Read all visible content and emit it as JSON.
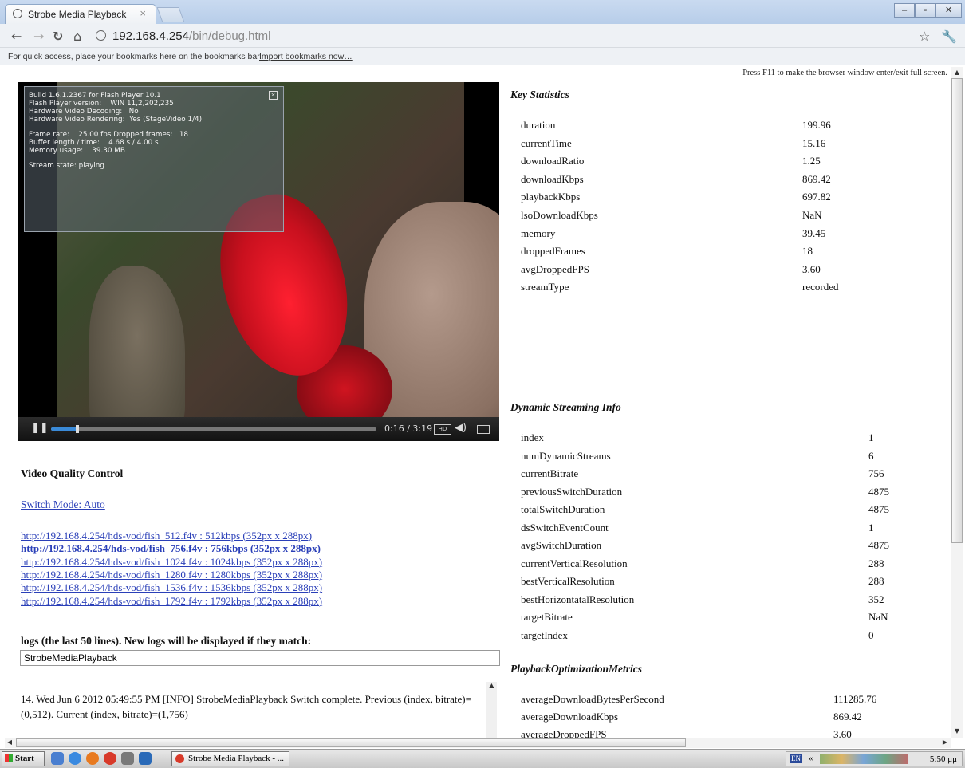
{
  "browser": {
    "tab_title": "Strobe Media Playback",
    "url_host": "192.168.4.254",
    "url_path": "/bin/debug.html",
    "bookmarks_hint": "For quick access, place your bookmarks here on the bookmarks bar.",
    "import_link": "Import bookmarks now…"
  },
  "page": {
    "fullscreen_hint": "Press F11 to make the browser window enter/exit full screen."
  },
  "player": {
    "overlay_lines": [
      "Build 1.6.1.2367 for Flash Player 10.1",
      "Flash Player version:    WIN 11,2,202,235",
      "Hardware Video Decoding:   No",
      "Hardware Video Rendering:  Yes (StageVideo 1/4)",
      "",
      "Frame rate:    25.00 fps Dropped frames:   18",
      "Buffer length / time:    4.68 s / 4.00 s",
      "Memory usage:    39.30 MB",
      "",
      "Stream state: playing"
    ],
    "time_display": "0:16 / 3:19",
    "progress_fraction": 0.08
  },
  "quality_control": {
    "title": "Video Quality Control",
    "switch_mode": "Switch Mode: Auto",
    "streams": [
      "http://192.168.4.254/hds-vod/fish_512.f4v : 512kbps (352px x 288px)",
      "http://192.168.4.254/hds-vod/fish_756.f4v : 756kbps (352px x 288px)",
      "http://192.168.4.254/hds-vod/fish_1024.f4v : 1024kbps (352px x 288px)",
      "http://192.168.4.254/hds-vod/fish_1280.f4v : 1280kbps (352px x 288px)",
      "http://192.168.4.254/hds-vod/fish_1536.f4v : 1536kbps (352px x 288px)",
      "http://192.168.4.254/hds-vod/fish_1792.f4v : 1792kbps (352px x 288px)"
    ],
    "active_stream_index": 1
  },
  "logs": {
    "title": "logs (the last 50 lines). New logs will be displayed if they match:",
    "filter_value": "StrobeMediaPlayback",
    "entry": "14. Wed Jun 6 2012 05:49:55 PM [INFO] StrobeMediaPlayback Switch complete. Previous (index, bitrate)=(0,512). Current (index, bitrate)=(1,756)"
  },
  "key_statistics": {
    "title": "Key Statistics",
    "rows": [
      {
        "key": "duration",
        "value": "199.96"
      },
      {
        "key": "currentTime",
        "value": "15.16"
      },
      {
        "key": "downloadRatio",
        "value": "1.25"
      },
      {
        "key": "downloadKbps",
        "value": "869.42"
      },
      {
        "key": "playbackKbps",
        "value": "697.82"
      },
      {
        "key": "lsoDownloadKbps",
        "value": "NaN"
      },
      {
        "key": "memory",
        "value": "39.45"
      },
      {
        "key": "droppedFrames",
        "value": "18"
      },
      {
        "key": "avgDroppedFPS",
        "value": "3.60"
      },
      {
        "key": "streamType",
        "value": "recorded"
      }
    ]
  },
  "dynamic_streaming": {
    "title": "Dynamic Streaming Info",
    "rows": [
      {
        "key": "index",
        "value": "1"
      },
      {
        "key": "numDynamicStreams",
        "value": "6"
      },
      {
        "key": "currentBitrate",
        "value": "756"
      },
      {
        "key": "previousSwitchDuration",
        "value": "4875"
      },
      {
        "key": "totalSwitchDuration",
        "value": "4875"
      },
      {
        "key": "dsSwitchEventCount",
        "value": "1"
      },
      {
        "key": "avgSwitchDuration",
        "value": "4875"
      },
      {
        "key": "currentVerticalResolution",
        "value": "288"
      },
      {
        "key": "bestVerticalResolution",
        "value": "288"
      },
      {
        "key": "bestHorizontatalResolution",
        "value": "352"
      },
      {
        "key": "targetBitrate",
        "value": "NaN"
      },
      {
        "key": "targetIndex",
        "value": "0"
      }
    ]
  },
  "playback_optimization": {
    "title": "PlaybackOptimizationMetrics",
    "rows": [
      {
        "key": "averageDownloadBytesPerSecond",
        "value": "111285.76"
      },
      {
        "key": "averageDownloadKbps",
        "value": "869.42"
      },
      {
        "key": "averageDroppedFPS",
        "value": "3.60"
      }
    ]
  },
  "taskbar": {
    "start_label": "Start",
    "task_label": "Strobe Media Playback - ...",
    "lang": "EN",
    "clock": "5:50 μμ"
  }
}
